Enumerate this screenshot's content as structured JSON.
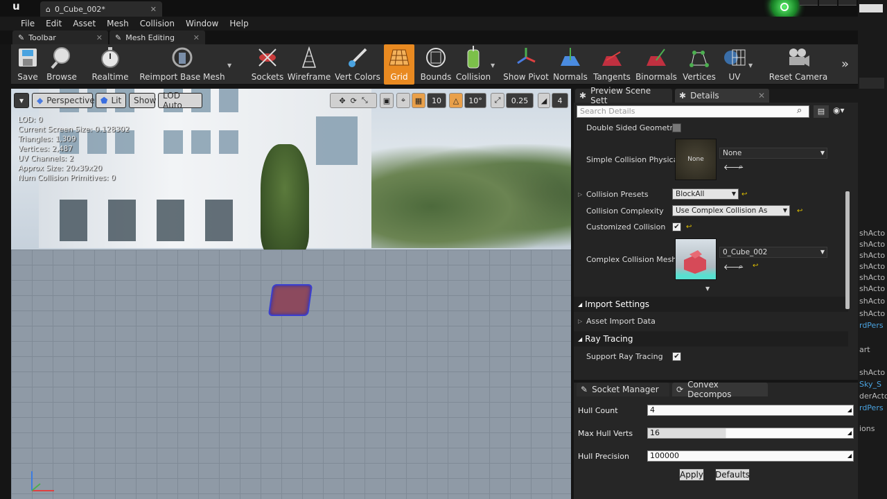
{
  "window": {
    "doc_tab_title": "0_Cube_002*"
  },
  "menu": [
    "File",
    "Edit",
    "Asset",
    "Mesh",
    "Collision",
    "Window",
    "Help"
  ],
  "subtabs": {
    "toolbar": "Toolbar",
    "mesh_editing": "Mesh Editing"
  },
  "toolbar": {
    "save": "Save",
    "browse": "Browse",
    "realtime": "Realtime",
    "reimport": "Reimport Base Mesh",
    "sockets": "Sockets",
    "wireframe": "Wireframe",
    "vert_colors": "Vert Colors",
    "grid": "Grid",
    "bounds": "Bounds",
    "collision": "Collision",
    "show_pivot": "Show Pivot",
    "normals": "Normals",
    "tangents": "Tangents",
    "binormals": "Binormals",
    "vertices": "Vertices",
    "uv": "UV",
    "reset_camera": "Reset Camera",
    "more": "»"
  },
  "viewport": {
    "perspective": "Perspective",
    "lit": "Lit",
    "show": "Show",
    "lod": "LOD Auto",
    "grid_snap": "10",
    "rot_snap": "10°",
    "scale_snap": "0.25",
    "cam_speed": "4",
    "stats": [
      "LOD:  0",
      "Current Screen Size:  0.128302",
      "Triangles:  1,309",
      "Vertices:  2,487",
      "UV Channels:  2",
      "Approx Size: 20x39x20",
      "Num Collision Primitives:  0"
    ]
  },
  "details": {
    "tab_preview": "Preview Scene Sett",
    "tab_details": "Details",
    "search_placeholder": "Search Details",
    "double_sided": "Double Sided Geometry",
    "simple_collision": "Simple Collision Physical",
    "simple_thumb": "None",
    "simple_value": "None",
    "collision_presets": "Collision Presets",
    "collision_presets_value": "BlockAll",
    "collision_complexity": "Collision Complexity",
    "collision_complexity_value": "Use Complex Collision As Simple",
    "customized_collision": "Customized Collision",
    "complex_mesh": "Complex Collision Mesh",
    "complex_mesh_value": "0_Cube_002",
    "import_settings": "Import Settings",
    "asset_import_data": "Asset Import Data",
    "ray_tracing": "Ray Tracing",
    "support_ray_tracing": "Support Ray Tracing"
  },
  "convex": {
    "tab_socket": "Socket Manager",
    "tab_convex": "Convex Decompos",
    "hull_count_label": "Hull Count",
    "hull_count": "4",
    "max_hull_verts_label": "Max Hull Verts",
    "max_hull_verts": "16",
    "hull_precision_label": "Hull Precision",
    "hull_precision": "100000",
    "apply": "Apply",
    "defaults": "Defaults"
  },
  "right_strip": [
    "shActo",
    "shActo",
    "shActo",
    "shActo",
    "shActo",
    "shActo",
    "shActo",
    "shActo",
    "rdPers",
    "art",
    "shActo",
    "Sky_S",
    "derActo",
    "rdPers",
    "ions"
  ],
  "colors": {
    "accent_orange": "#e98a21",
    "panel": "#242424",
    "green_button": "#2fbf3f"
  }
}
